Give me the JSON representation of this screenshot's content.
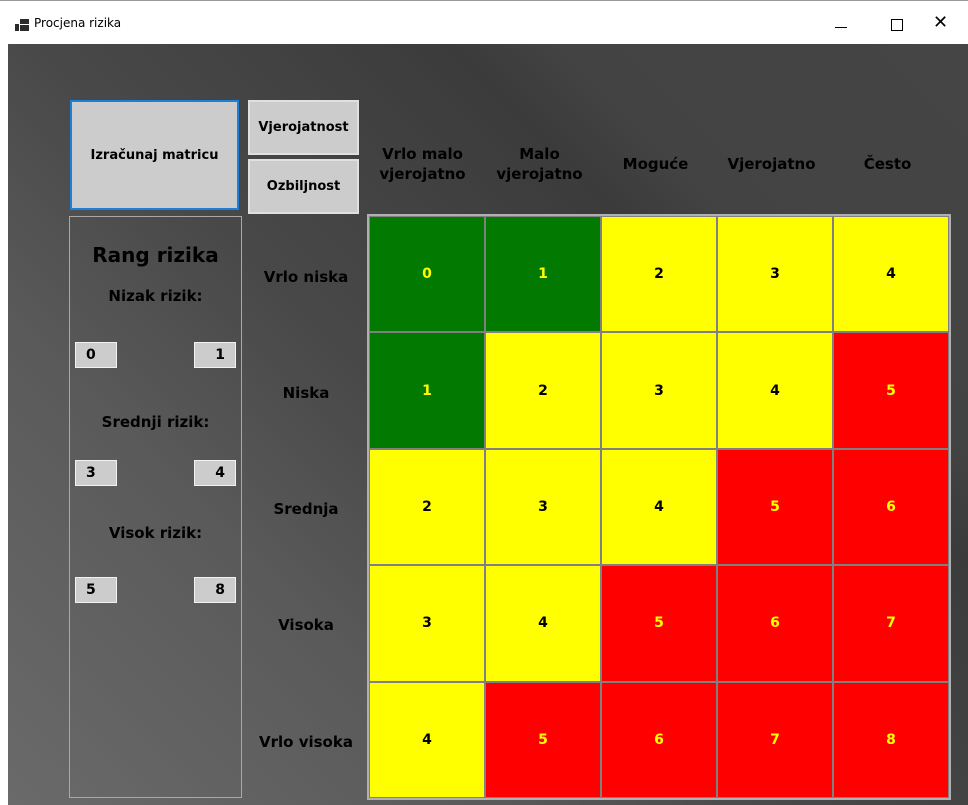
{
  "window": {
    "title": "Procjena rizika",
    "app_icon": "app-window-icon",
    "controls": [
      "minimize-icon",
      "maximize-icon",
      "close-icon"
    ],
    "close_glyph": "✕"
  },
  "toolbar": {
    "calculate_label": "Izračunaj matricu",
    "probability_label": "Vjerojatnost",
    "severity_label": "Ozbiljnost"
  },
  "probability_levels": [
    "Vrlo malo vjerojatno",
    "Malo vjerojatno",
    "Moguće",
    "Vjerojatno",
    "Često"
  ],
  "severity_levels": [
    "Vrlo niska",
    "Niska",
    "Srednja",
    "Visoka",
    "Vrlo visoka"
  ],
  "rank_panel": {
    "title": "Rang rizika",
    "low_label": "Nizak rizik:",
    "low_min": "0",
    "low_max": "1",
    "medium_label": "Srednji rizik:",
    "medium_min": "3",
    "medium_max": "4",
    "high_label": "Visok rizik:",
    "high_min": "5",
    "high_max": "8"
  },
  "matrix": {
    "rows": [
      [
        "0",
        "1",
        "2",
        "3",
        "4"
      ],
      [
        "1",
        "2",
        "3",
        "4",
        "5"
      ],
      [
        "2",
        "3",
        "4",
        "5",
        "6"
      ],
      [
        "3",
        "4",
        "5",
        "6",
        "7"
      ],
      [
        "4",
        "5",
        "6",
        "7",
        "8"
      ]
    ],
    "colors": [
      [
        "green",
        "green",
        "yellow",
        "yellow",
        "yellow"
      ],
      [
        "green",
        "yellow",
        "yellow",
        "yellow",
        "red"
      ],
      [
        "yellow",
        "yellow",
        "yellow",
        "red",
        "red"
      ],
      [
        "yellow",
        "yellow",
        "red",
        "red",
        "red"
      ],
      [
        "yellow",
        "red",
        "red",
        "red",
        "red"
      ]
    ]
  },
  "palette": {
    "green": "#027a02",
    "yellow": "#ffff00",
    "red": "#ff0000",
    "accent_border": "#1e7fd8",
    "button_bg": "#cccccc"
  }
}
